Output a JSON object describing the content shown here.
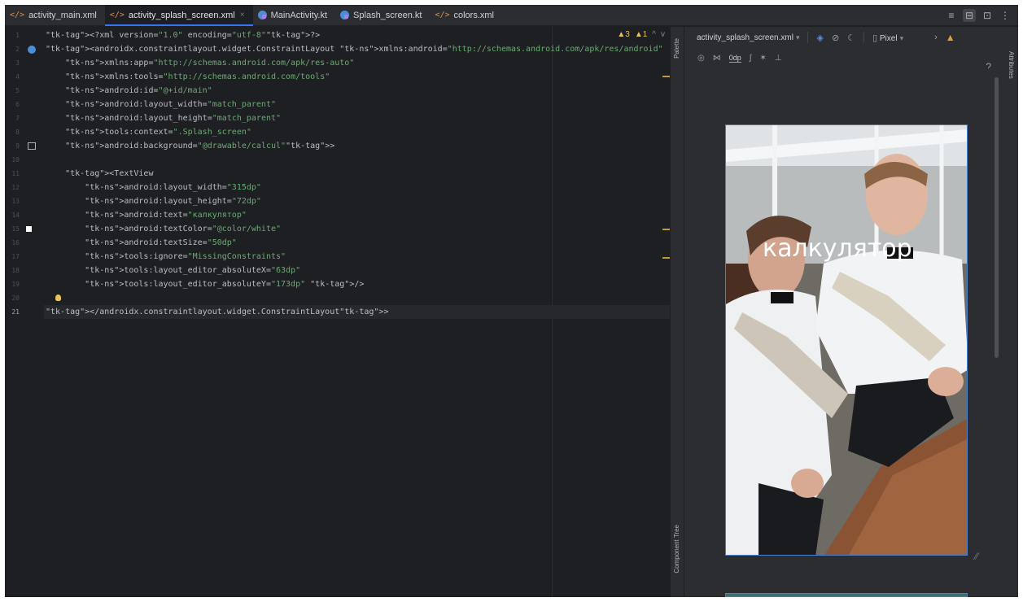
{
  "tabs": [
    {
      "icon": "</>",
      "type": "xml",
      "label": "activity_main.xml",
      "active": false
    },
    {
      "icon": "</>",
      "type": "xml",
      "label": "activity_splash_screen.xml",
      "active": true,
      "close": "×"
    },
    {
      "icon": "",
      "type": "kt",
      "label": "MainActivity.kt",
      "active": false
    },
    {
      "icon": "",
      "type": "kt",
      "label": "Splash_screen.kt",
      "active": false
    },
    {
      "icon": "</>",
      "type": "xml",
      "label": "colors.xml",
      "active": false
    }
  ],
  "view_modes": {
    "code": "≡",
    "split": "⊟",
    "design": "⊡",
    "more": "⋮"
  },
  "inspections": {
    "warnings": "▲3",
    "weak_warnings": "▲1",
    "up": "^",
    "down": "v"
  },
  "line_numbers": [
    "1",
    "2",
    "3",
    "4",
    "5",
    "6",
    "7",
    "8",
    "9",
    "10",
    "11",
    "12",
    "13",
    "14",
    "15",
    "16",
    "17",
    "18",
    "19",
    "20",
    "21"
  ],
  "code_lines": [
    "<?xml version=\"1.0\" encoding=\"utf-8\"?>",
    "<androidx.constraintlayout.widget.ConstraintLayout xmlns:android=\"http://schemas.android.com/apk/res/android\"",
    "    xmlns:app=\"http://schemas.android.com/apk/res-auto\"",
    "    xmlns:tools=\"http://schemas.android.com/tools\"",
    "    android:id=\"@+id/main\"",
    "    android:layout_width=\"match_parent\"",
    "    android:layout_height=\"match_parent\"",
    "    tools:context=\".Splash_screen\"",
    "    android:background=\"@drawable/calcul\">",
    "",
    "    <TextView",
    "        android:layout_width=\"315dp\"",
    "        android:layout_height=\"72dp\"",
    "        android:text=\"калкулятор\"",
    "        android:textColor=\"@color/white\"",
    "        android:textSize=\"50dp\"",
    "        tools:ignore=\"MissingConstraints\"",
    "        tools:layout_editor_absoluteX=\"63dp\"",
    "        tools:layout_editor_absoluteY=\"173dp\" />",
    "",
    "</androidx.constraintlayout.widget.ConstraintLayout>"
  ],
  "current_line": 21,
  "side_panels": {
    "palette": "Palette",
    "component_tree": "Component Tree",
    "attributes": "Attributes"
  },
  "design_toolbar": {
    "file_selector": "activity_splash_screen.xml",
    "device_selector": "Pixel",
    "margin_value": "0dp",
    "help": "?"
  },
  "preview": {
    "text": "калкулятор",
    "text_color": "#ffffff"
  },
  "colors": {
    "accent": "#3574f0",
    "background": "#1e1f22",
    "panel": "#2b2d30",
    "xml_icon": "#e08e4b",
    "warning": "#e6a12a"
  }
}
